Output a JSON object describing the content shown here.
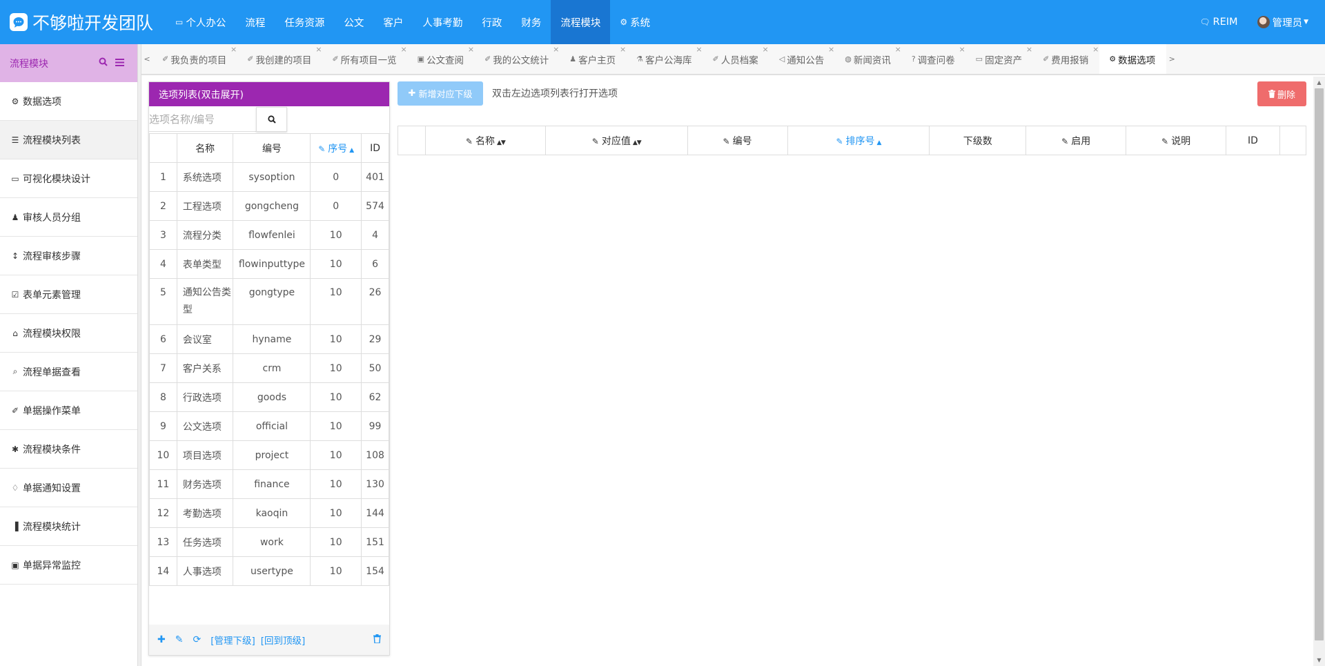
{
  "brand": {
    "title": "不够啦开发团队"
  },
  "topnav": [
    {
      "label": "个人办公",
      "icon": "monitor-icon",
      "active": false
    },
    {
      "label": "流程",
      "active": false
    },
    {
      "label": "任务资源",
      "active": false
    },
    {
      "label": "公文",
      "active": false
    },
    {
      "label": "客户",
      "active": false
    },
    {
      "label": "人事考勤",
      "active": false
    },
    {
      "label": "行政",
      "active": false
    },
    {
      "label": "财务",
      "active": false
    },
    {
      "label": "流程模块",
      "active": true
    },
    {
      "label": "系统",
      "icon": "gear-icon",
      "active": false
    }
  ],
  "topright": {
    "reim": "REIM",
    "user": "管理员"
  },
  "sidebar": {
    "title": "流程模块",
    "items": [
      {
        "label": "数据选项",
        "icon": "gear-icon"
      },
      {
        "label": "流程模块列表",
        "icon": "list-icon"
      },
      {
        "label": "可视化模块设计",
        "icon": "monitor-icon"
      },
      {
        "label": "审核人员分组",
        "icon": "users-icon"
      },
      {
        "label": "流程审核步骤",
        "icon": "arrows-vertical-icon"
      },
      {
        "label": "表单元素管理",
        "icon": "checkbox-icon"
      },
      {
        "label": "流程模块权限",
        "icon": "lock-icon"
      },
      {
        "label": "流程单据查看",
        "icon": "search-icon"
      },
      {
        "label": "单据操作菜单",
        "icon": "bookmark-icon"
      },
      {
        "label": "流程模块条件",
        "icon": "asterisk-icon"
      },
      {
        "label": "单据通知设置",
        "icon": "bell-icon"
      },
      {
        "label": "流程模块统计",
        "icon": "bar-chart-icon"
      },
      {
        "label": "单据异常监控",
        "icon": "briefcase-icon"
      }
    ]
  },
  "tabs": [
    {
      "label": "我负责的项目",
      "icon": "bookmark-icon"
    },
    {
      "label": "我创建的项目",
      "icon": "bookmark-icon"
    },
    {
      "label": "所有项目一览",
      "icon": "bookmark-icon"
    },
    {
      "label": "公文查阅",
      "icon": "briefcase-icon"
    },
    {
      "label": "我的公文统计",
      "icon": "bookmark-icon"
    },
    {
      "label": "客户主页",
      "icon": "user-icon"
    },
    {
      "label": "客户公海库",
      "icon": "flask-icon"
    },
    {
      "label": "人员档案",
      "icon": "bookmark-icon"
    },
    {
      "label": "通知公告",
      "icon": "speaker-icon"
    },
    {
      "label": "新闻资讯",
      "icon": "globe-icon"
    },
    {
      "label": "调查问卷",
      "icon": "question-icon"
    },
    {
      "label": "固定资产",
      "icon": "laptop-icon"
    },
    {
      "label": "费用报销",
      "icon": "bookmark-icon"
    },
    {
      "label": "数据选项",
      "icon": "gear-icon",
      "active": true
    }
  ],
  "options_panel": {
    "title": "选项列表(双击展开)",
    "search_placeholder": "选项名称/编号",
    "columns": [
      "",
      "名称",
      "编号",
      "序号",
      "ID"
    ],
    "rows": [
      {
        "no": "1",
        "name": "系统选项",
        "code": "sysoption",
        "sort": "0",
        "id": "401"
      },
      {
        "no": "2",
        "name": "工程选项",
        "code": "gongcheng",
        "sort": "0",
        "id": "574"
      },
      {
        "no": "3",
        "name": "流程分类",
        "code": "flowfenlei",
        "sort": "10",
        "id": "4"
      },
      {
        "no": "4",
        "name": "表单类型",
        "code": "flowinputtype",
        "sort": "10",
        "id": "6"
      },
      {
        "no": "5",
        "name": "通知公告类型",
        "code": "gongtype",
        "sort": "10",
        "id": "26"
      },
      {
        "no": "6",
        "name": "会议室",
        "code": "hyname",
        "sort": "10",
        "id": "29"
      },
      {
        "no": "7",
        "name": "客户关系",
        "code": "crm",
        "sort": "10",
        "id": "50"
      },
      {
        "no": "8",
        "name": "行政选项",
        "code": "goods",
        "sort": "10",
        "id": "62"
      },
      {
        "no": "9",
        "name": "公文选项",
        "code": "official",
        "sort": "10",
        "id": "99"
      },
      {
        "no": "10",
        "name": "项目选项",
        "code": "project",
        "sort": "10",
        "id": "108"
      },
      {
        "no": "11",
        "name": "财务选项",
        "code": "finance",
        "sort": "10",
        "id": "130"
      },
      {
        "no": "12",
        "name": "考勤选项",
        "code": "kaoqin",
        "sort": "10",
        "id": "144"
      },
      {
        "no": "13",
        "name": "任务选项",
        "code": "work",
        "sort": "10",
        "id": "151"
      },
      {
        "no": "14",
        "name": "人事选项",
        "code": "usertype",
        "sort": "10",
        "id": "154"
      }
    ],
    "footer": {
      "manage_sub": "[管理下级]",
      "back_top": "[回到顶级]"
    }
  },
  "detail": {
    "add_button": "新增对应下级",
    "hint": "双击左边选项列表行打开选项",
    "delete_button": "删除",
    "columns": [
      "",
      "名称",
      "对应值",
      "编号",
      "排序号",
      "下级数",
      "启用",
      "说明",
      "ID",
      ""
    ]
  },
  "colors": {
    "primary": "#2196f3",
    "accent_purple": "#9c27b0",
    "danger": "#ef6c6c"
  }
}
